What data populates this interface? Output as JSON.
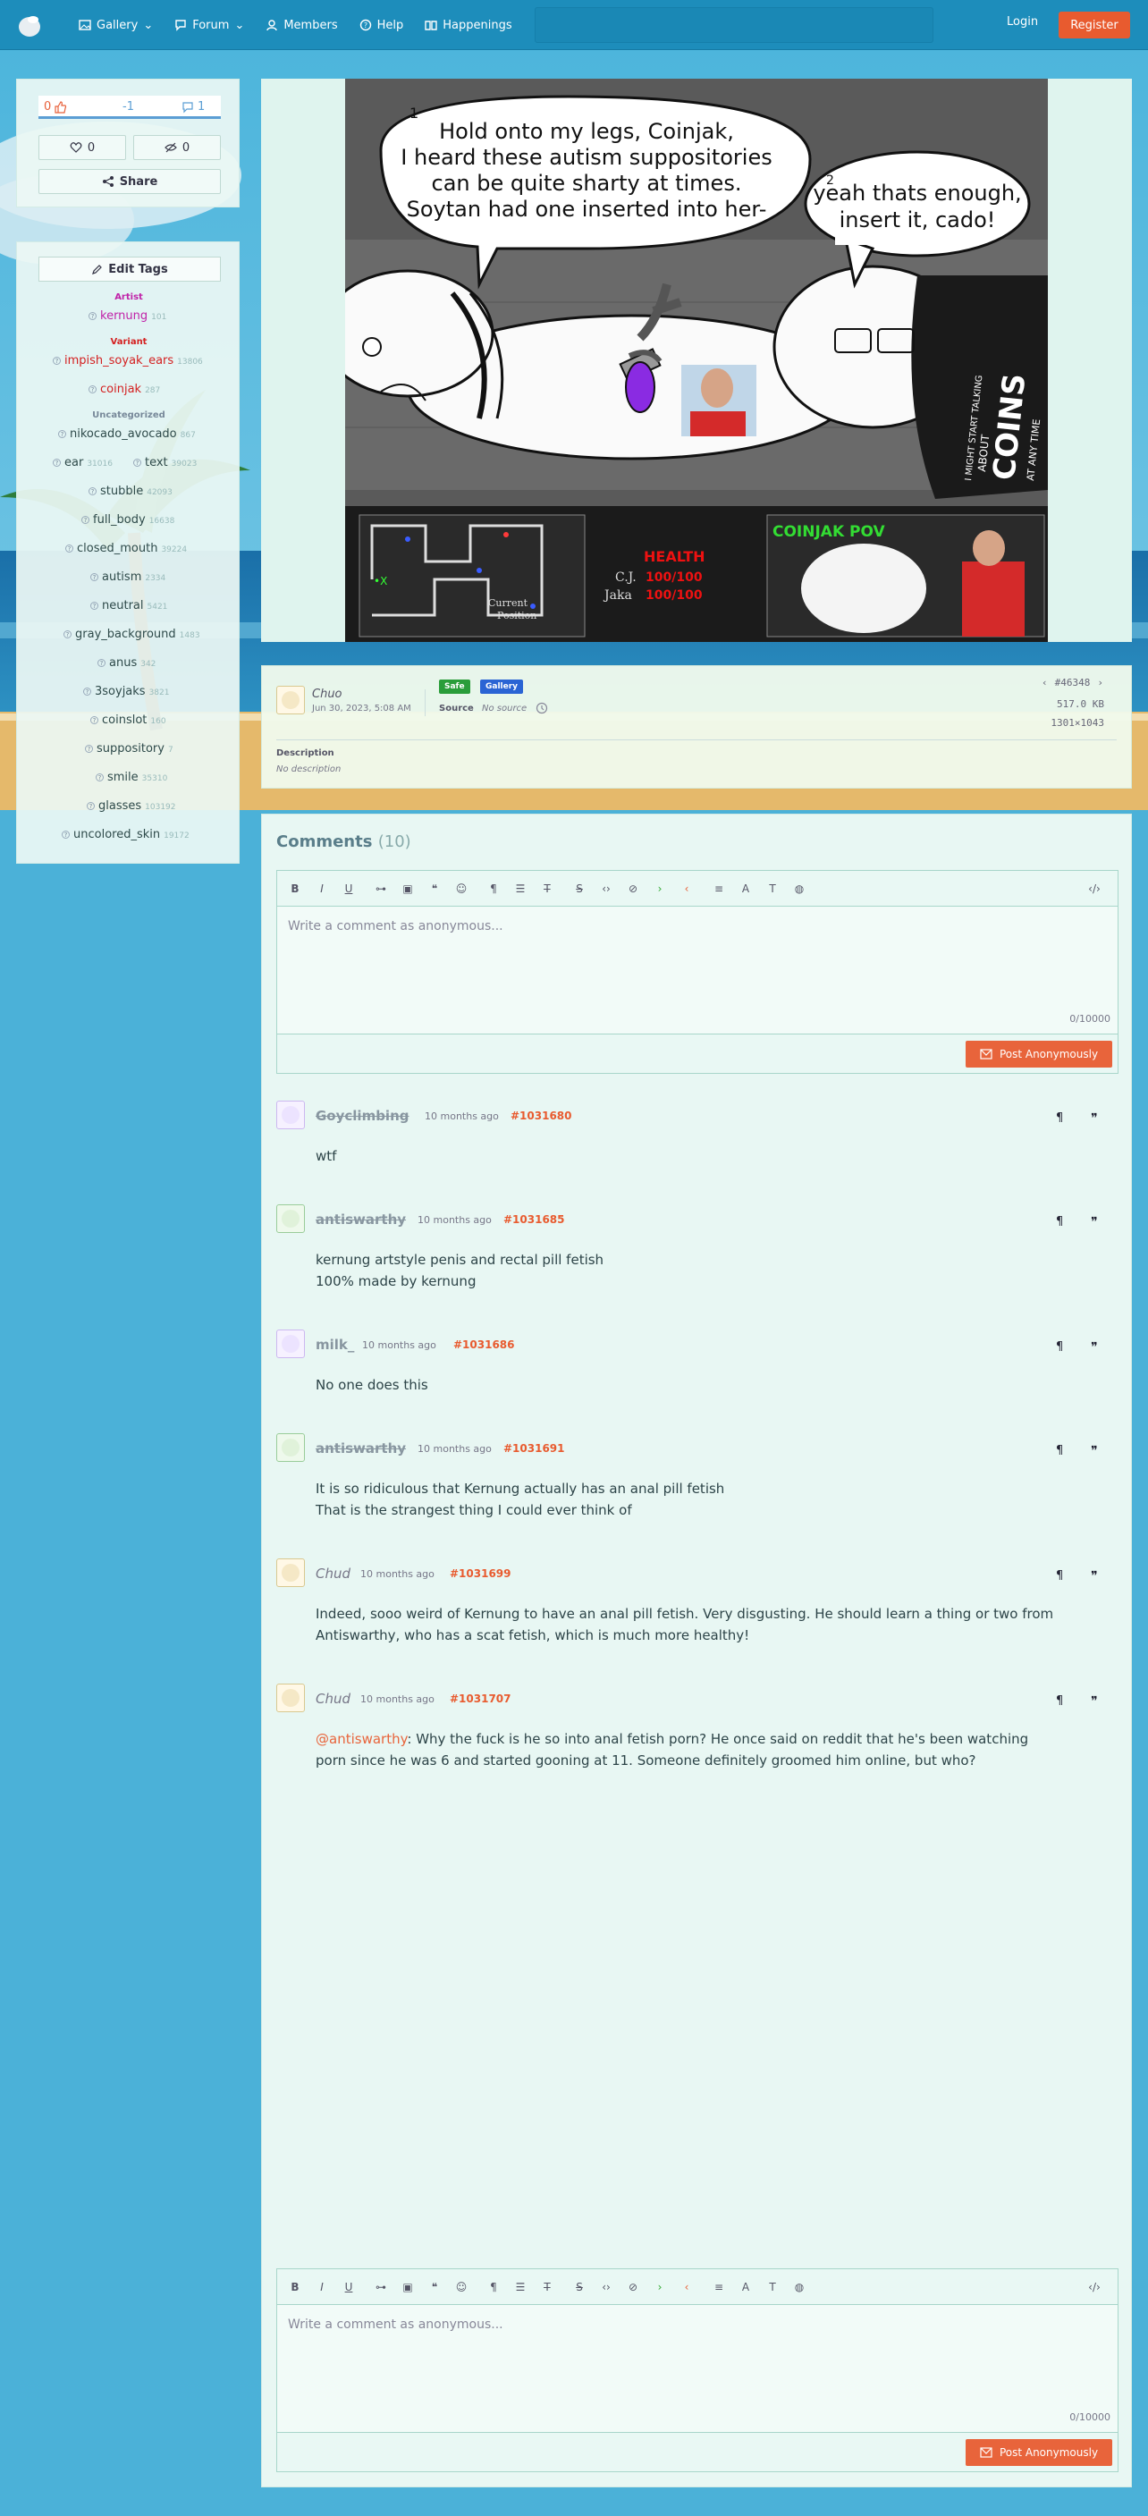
{
  "header": {
    "nav": [
      {
        "label": "Gallery",
        "icon": "image-icon",
        "dropdown": true
      },
      {
        "label": "Forum",
        "icon": "chat-icon",
        "dropdown": true
      },
      {
        "label": "Members",
        "icon": "user-icon",
        "dropdown": false
      },
      {
        "label": "Help",
        "icon": "help-icon",
        "dropdown": false
      },
      {
        "label": "Happenings",
        "icon": "book-icon",
        "dropdown": false
      }
    ],
    "login": "Login",
    "register": "Register"
  },
  "stats": {
    "upvotes": "0",
    "score": "-1",
    "downvotes": "1",
    "favorites": "0",
    "hides": "0",
    "share": "Share"
  },
  "tags": {
    "edit_label": "Edit Tags",
    "cat_artist": "Artist",
    "cat_variant": "Variant",
    "cat_uncategorized": "Uncategorized",
    "artist": [
      {
        "name": "kernung",
        "count": "101"
      }
    ],
    "variant": [
      {
        "name": "impish_soyak_ears",
        "count": "13806"
      },
      {
        "name": "coinjak",
        "count": "287"
      }
    ],
    "uncategorized": [
      {
        "name": "nikocado_avocado",
        "count": "867"
      },
      {
        "name": "ear",
        "count": "31016"
      },
      {
        "name": "text",
        "count": "39023"
      },
      {
        "name": "stubble",
        "count": "42093"
      },
      {
        "name": "full_body",
        "count": "16638"
      },
      {
        "name": "closed_mouth",
        "count": "39224"
      },
      {
        "name": "autism",
        "count": "2334"
      },
      {
        "name": "neutral",
        "count": "5421"
      },
      {
        "name": "gray_background",
        "count": "1483"
      },
      {
        "name": "anus",
        "count": "342"
      },
      {
        "name": "3soyjaks",
        "count": "3821"
      },
      {
        "name": "coinslot",
        "count": "160"
      },
      {
        "name": "suppository",
        "count": "7"
      },
      {
        "name": "smile",
        "count": "35310"
      },
      {
        "name": "glasses",
        "count": "103192"
      },
      {
        "name": "uncolored_skin",
        "count": "19172"
      }
    ]
  },
  "image": {
    "bubble1": [
      "Hold onto my legs, Coinjak,",
      "I heard these autism suppositories",
      "can be quite sharty at times.",
      "Soytan had one inserted into her-"
    ],
    "bubble1_num": "1",
    "bubble2": [
      "yeah thats enough,",
      "insert it, cado!"
    ],
    "bubble2_num": "2",
    "shirt_text": [
      "I MIGHT START TALKING",
      "ABOUT",
      "COINS",
      "AT ANY TIME"
    ],
    "map_marker": "•X",
    "map_caption": [
      "Current",
      "Position"
    ],
    "health_label": "HEALTH",
    "health_rows": [
      {
        "name": "C.J.",
        "value": "100/100"
      },
      {
        "name": "Jaka",
        "value": "100/100"
      }
    ],
    "pov_label": "COINJAK POV"
  },
  "info": {
    "uploader": "Chuo",
    "date": "Jun 30, 2023, 5:08 AM",
    "rating_badge": "Safe",
    "board_badge": "Gallery",
    "source_label": "Source",
    "source_value": "No source",
    "image_id": "#46348",
    "file_size": "517.0 KB",
    "dimensions": "1301×1043",
    "description_label": "Description",
    "description_value": "No description"
  },
  "comments": {
    "title": "Comments",
    "count": "(10)",
    "placeholder": "Write a comment as anonymous...",
    "char_counter": "0/10000",
    "post_label": "Post Anonymously",
    "items": [
      {
        "author": "Goyclimbing",
        "time": "10 months ago",
        "id": "#1031680",
        "lines": [
          "wtf"
        ]
      },
      {
        "author": "antiswarthy",
        "time": "10 months ago",
        "id": "#1031685",
        "lines": [
          "kernung artstyle penis and rectal pill fetish",
          "100% made by kernung"
        ]
      },
      {
        "author": "milk_",
        "time": "10 months ago",
        "id": "#1031686",
        "lines": [
          "No one does this"
        ]
      },
      {
        "author": "antiswarthy",
        "time": "10 months ago",
        "id": "#1031691",
        "lines": [
          "It is so ridiculous that Kernung actually has an anal pill fetish",
          "That is the strangest thing I could ever think of"
        ]
      },
      {
        "author": "Chud",
        "time": "10 months ago",
        "id": "#1031699",
        "lines": [
          "Indeed, sooo weird of Kernung to have an anal pill fetish. Very disgusting. He should learn a thing or two from",
          "Antiswarthy, who has a scat fetish, which is much more healthy!"
        ]
      },
      {
        "author": "Chud",
        "time": "10 months ago",
        "id": "#1031707",
        "mention": "@antiswarthy",
        "lines": [
          ": Why the fuck is he so into anal fetish porn? He once said on reddit that he's been watching",
          "porn since he was 6 and started gooning at 11. Someone definitely groomed him online, but who?"
        ]
      }
    ]
  }
}
